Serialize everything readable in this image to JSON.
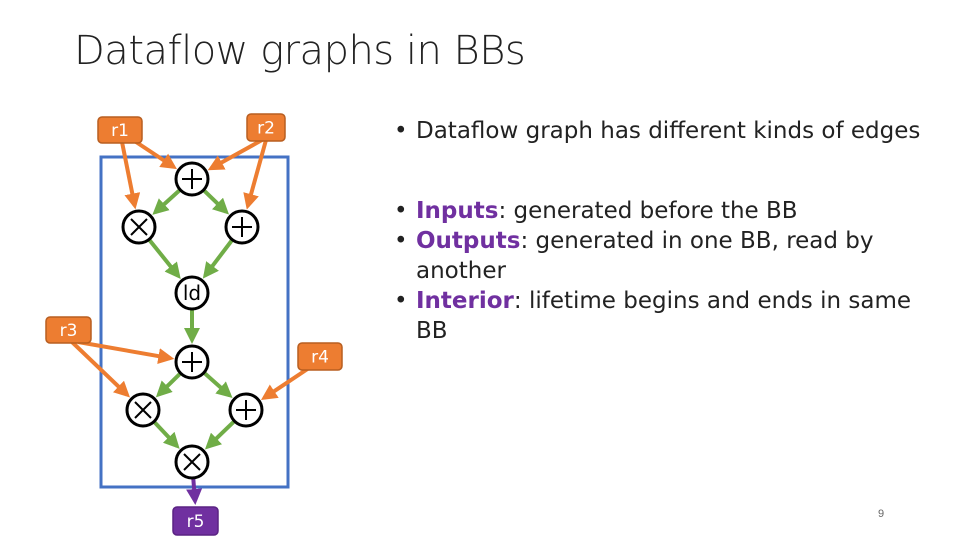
{
  "slide": {
    "title": "Dataflow graphs in BBs",
    "page_number": "9",
    "bullets": [
      {
        "keyword": "",
        "text": "Dataflow graph has different kinds of edges"
      },
      {
        "keyword": "Inputs",
        "text": ": generated before the BB"
      },
      {
        "keyword": "Outputs",
        "text": ": generated in one BB, read by another"
      },
      {
        "keyword": "Interior",
        "text": ": lifetime begins and ends in same BB"
      }
    ]
  },
  "diagram": {
    "colors": {
      "input": "#ED7D31",
      "interior": "#70AD47",
      "output": "#7030A0",
      "block": "#4472C4",
      "keyword": "#7030A0"
    },
    "registers": {
      "r1": "r1",
      "r2": "r2",
      "r3": "r3",
      "r4": "r4",
      "r5": "r5"
    },
    "nodes": {
      "n1": "+",
      "n2": "×",
      "n3": "+",
      "n4": "ld",
      "n5": "+",
      "n6": "×",
      "n7": "+",
      "n8": "×"
    },
    "edges": [
      {
        "from": "r1",
        "to": "n1",
        "kind": "input"
      },
      {
        "from": "r1",
        "to": "n2",
        "kind": "input"
      },
      {
        "from": "r2",
        "to": "n1",
        "kind": "input"
      },
      {
        "from": "r2",
        "to": "n3",
        "kind": "input"
      },
      {
        "from": "n1",
        "to": "n2",
        "kind": "interior"
      },
      {
        "from": "n1",
        "to": "n3",
        "kind": "interior"
      },
      {
        "from": "n2",
        "to": "n4",
        "kind": "interior"
      },
      {
        "from": "n3",
        "to": "n4",
        "kind": "interior"
      },
      {
        "from": "n4",
        "to": "n5",
        "kind": "interior"
      },
      {
        "from": "r3",
        "to": "n5",
        "kind": "input"
      },
      {
        "from": "r3",
        "to": "n6",
        "kind": "input"
      },
      {
        "from": "r4",
        "to": "n7",
        "kind": "input"
      },
      {
        "from": "n5",
        "to": "n6",
        "kind": "interior"
      },
      {
        "from": "n5",
        "to": "n7",
        "kind": "interior"
      },
      {
        "from": "n6",
        "to": "n8",
        "kind": "interior"
      },
      {
        "from": "n7",
        "to": "n8",
        "kind": "interior"
      },
      {
        "from": "n8",
        "to": "r5",
        "kind": "output"
      }
    ]
  }
}
